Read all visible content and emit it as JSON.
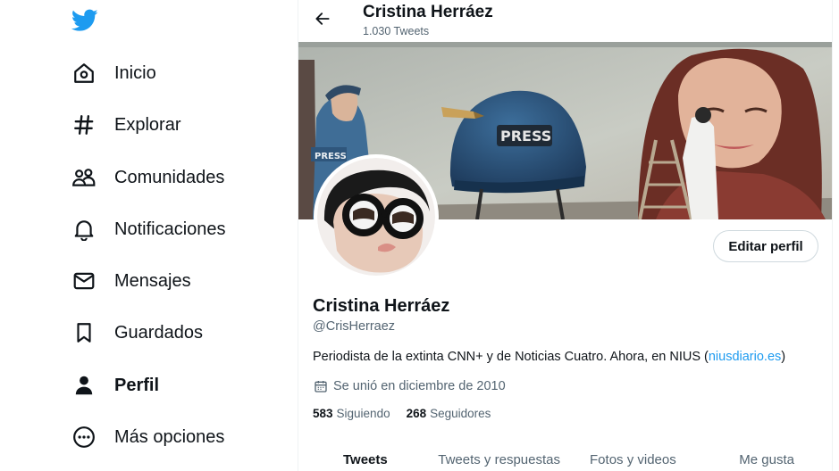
{
  "sidebar": {
    "logo_icon": "twitter-bird-icon",
    "items": [
      {
        "label": "Inicio",
        "icon": "home-icon"
      },
      {
        "label": "Explorar",
        "icon": "hashtag-icon"
      },
      {
        "label": "Comunidades",
        "icon": "communities-icon"
      },
      {
        "label": "Notificaciones",
        "icon": "bell-icon"
      },
      {
        "label": "Mensajes",
        "icon": "envelope-icon"
      },
      {
        "label": "Guardados",
        "icon": "bookmark-icon"
      },
      {
        "label": "Perfil",
        "icon": "person-icon",
        "active": true
      },
      {
        "label": "Más opciones",
        "icon": "more-circle-icon"
      }
    ]
  },
  "header": {
    "title": "Cristina Herráez",
    "subtitle": "1.030 Tweets",
    "back_icon": "arrow-left-icon"
  },
  "banner": {
    "helmet_text": "PRESS",
    "vest_text": "PRESS"
  },
  "profile": {
    "name": "Cristina Herráez",
    "handle": "@CrisHerraez",
    "bio_text": "Periodista de la extinta CNN+ y de Noticias Cuatro. Ahora, en NIUS (",
    "bio_link": "niusdiario.es",
    "bio_end": ")",
    "joined": "Se unió en diciembre de 2010",
    "following_count": "583",
    "following_label": "Siguiendo",
    "followers_count": "268",
    "followers_label": "Seguidores",
    "edit_button": "Editar perfil"
  },
  "tabs": [
    {
      "label": "Tweets",
      "active": true
    },
    {
      "label": "Tweets y respuestas"
    },
    {
      "label": "Fotos y videos"
    },
    {
      "label": "Me gusta"
    }
  ],
  "colors": {
    "accent": "#1d9bf0",
    "text": "#0f1419",
    "muted": "#536471",
    "border": "#cfd9de"
  }
}
